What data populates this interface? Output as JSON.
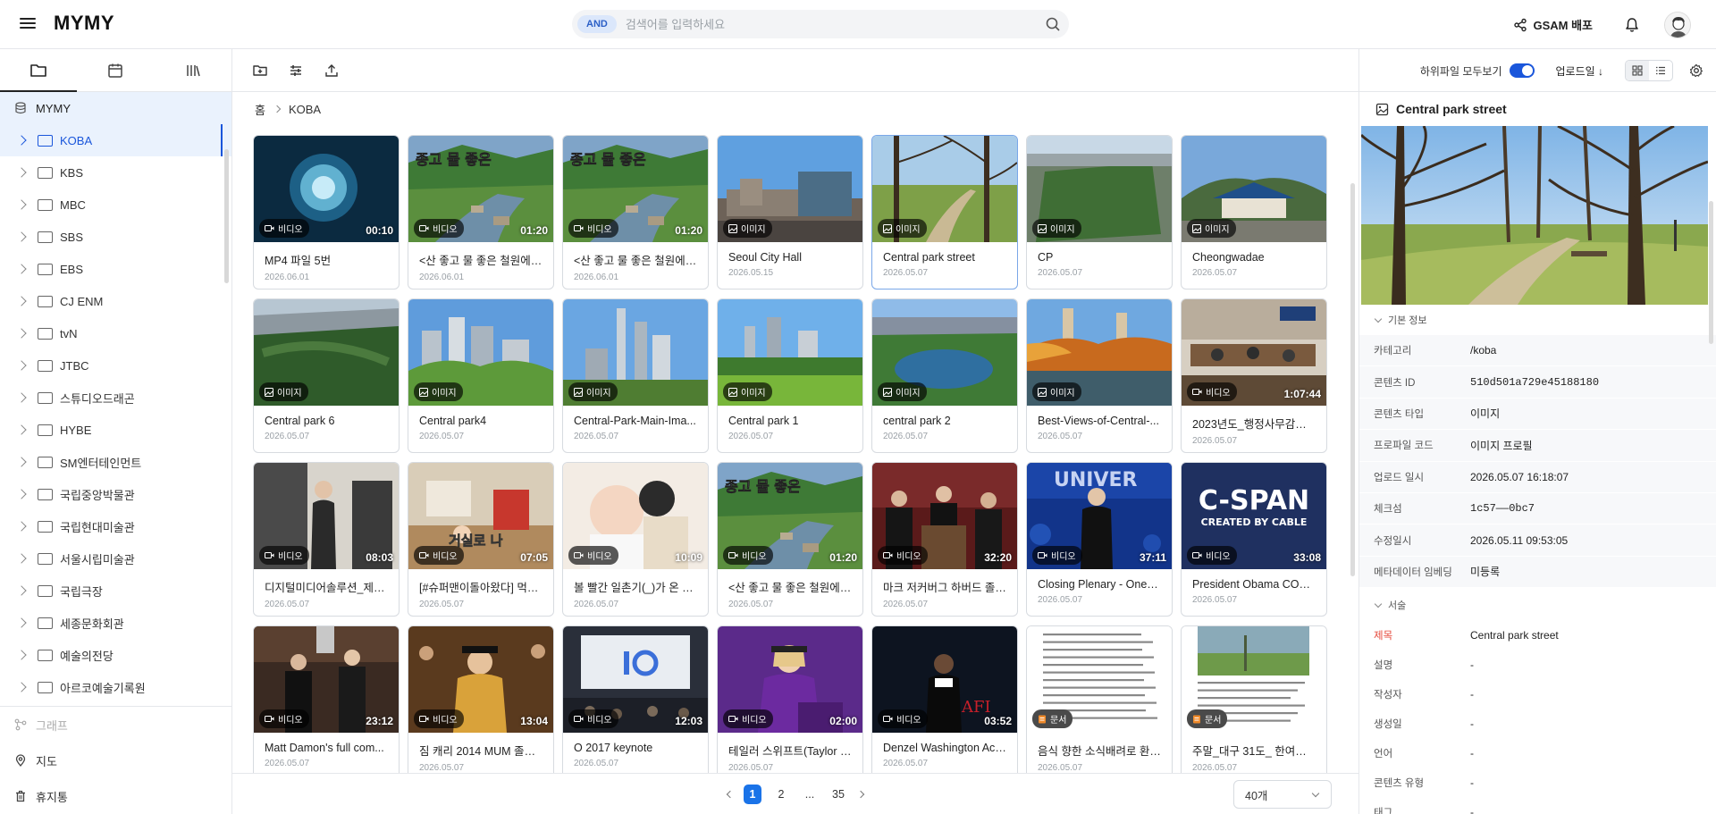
{
  "header": {
    "logo": "MYMY",
    "search_badge": "AND",
    "search_placeholder": "검색어를 입력하세요",
    "share_label": "GSAM 배포"
  },
  "sidebar": {
    "root": "MYMY",
    "items": [
      {
        "label": "KOBA",
        "active": true
      },
      {
        "label": "KBS"
      },
      {
        "label": "MBC"
      },
      {
        "label": "SBS"
      },
      {
        "label": "EBS"
      },
      {
        "label": "CJ ENM"
      },
      {
        "label": "tvN"
      },
      {
        "label": "JTBC"
      },
      {
        "label": "스튜디오드래곤"
      },
      {
        "label": "HYBE"
      },
      {
        "label": "SM엔터테인먼트"
      },
      {
        "label": "국립중앙박물관"
      },
      {
        "label": "국립현대미술관"
      },
      {
        "label": "서울시립미술관"
      },
      {
        "label": "국립극장"
      },
      {
        "label": "세종문화회관"
      },
      {
        "label": "예술의전당"
      },
      {
        "label": "아르코예술기록원"
      }
    ],
    "bottom": {
      "graph": "그래프",
      "map": "지도",
      "trash": "휴지통"
    }
  },
  "toolbar": {
    "subfolder_label": "하위파일 모두보기",
    "sort_label": "업로드일 ↓"
  },
  "breadcrumb": {
    "home": "홈",
    "current": "KOBA"
  },
  "cards": [
    {
      "title": "MP4 파일 5번",
      "date": "2026.06.01",
      "type": "비디오",
      "dur": "00:10",
      "art": "cell"
    },
    {
      "title": "<산 좋고 물 좋은 철원에 ...",
      "date": "2026.06.01",
      "type": "비디오",
      "dur": "01:20",
      "art": "river",
      "overlay": "종고 물 좋은"
    },
    {
      "title": "<산 좋고 물 좋은 철원에 ...",
      "date": "2026.06.01",
      "type": "비디오",
      "dur": "01:20",
      "art": "river",
      "overlay": "종고 물 좋은"
    },
    {
      "title": "Seoul City Hall",
      "date": "2026.05.15",
      "type": "이미지",
      "art": "cityhall"
    },
    {
      "title": "Central park street",
      "date": "2026.05.07",
      "type": "이미지",
      "art": "park",
      "selected": true
    },
    {
      "title": "CP",
      "date": "2026.05.07",
      "type": "이미지",
      "art": "aerial"
    },
    {
      "title": "Cheongwadae",
      "date": "2026.05.07",
      "type": "이미지",
      "art": "blue"
    },
    {
      "title": "Central park 6",
      "date": "2026.05.07",
      "type": "이미지",
      "art": "aerial2"
    },
    {
      "title": "Central park4",
      "date": "2026.05.07",
      "type": "이미지",
      "art": "city"
    },
    {
      "title": "Central-Park-Main-Ima...",
      "date": "2026.05.07",
      "type": "이미지",
      "art": "towers"
    },
    {
      "title": "Central park 1",
      "date": "2026.05.07",
      "type": "이미지",
      "art": "lawn"
    },
    {
      "title": "central park 2",
      "date": "2026.05.07",
      "type": "이미지",
      "art": "lake"
    },
    {
      "title": "Best-Views-of-Central-...",
      "date": "2026.05.07",
      "type": "이미지",
      "art": "autumn"
    },
    {
      "title": "2023년도_행정사무감사_...",
      "date": "2026.05.07",
      "type": "비디오",
      "dur": "1:07:44",
      "art": "meeting"
    },
    {
      "title": "디지털미디어솔루션_제머...",
      "date": "2026.05.07",
      "type": "비디오",
      "dur": "08:03",
      "art": "presenter"
    },
    {
      "title": "[#슈퍼맨이돌아왔다] 먹짱 ...",
      "date": "2026.05.07",
      "type": "비디오",
      "dur": "07:05",
      "art": "room",
      "overlay": "거실로 나"
    },
    {
      "title": "볼 빨간 일촌기(_)가 온 똥별...",
      "date": "2026.05.07",
      "type": "비디오",
      "dur": "10:09",
      "art": "baby"
    },
    {
      "title": "<산 좋고 물 좋은 철원에 ...",
      "date": "2026.05.07",
      "type": "비디오",
      "dur": "01:20",
      "art": "river",
      "overlay": "종고 물 좋은"
    },
    {
      "title": "마크 저커버그 하버드 졸업 ...",
      "date": "2026.05.07",
      "type": "비디오",
      "dur": "32:20",
      "art": "podium"
    },
    {
      "title": "Closing Plenary - One o...",
      "date": "2026.05.07",
      "type": "비디오",
      "dur": "37:11",
      "art": "clinton",
      "overlay": "UNIVER"
    },
    {
      "title": "President Obama COM...",
      "date": "2026.05.07",
      "type": "비디오",
      "dur": "33:08",
      "art": "cspan",
      "overlay": "C-SPAN",
      "overlay2": "CREATED BY CABLE"
    },
    {
      "title": "Matt Damon's full com...",
      "date": "2026.05.07",
      "type": "비디오",
      "dur": "23:12",
      "art": "grad"
    },
    {
      "title": "짐 캐리 2014 MUM 졸업...",
      "date": "2026.05.07",
      "type": "비디오",
      "dur": "13:04",
      "art": "gown"
    },
    {
      "title": "O 2017 keynote",
      "date": "2026.05.07",
      "type": "비디오",
      "dur": "12:03",
      "art": "io"
    },
    {
      "title": "테일러 스위프트(Taylor S...",
      "date": "2026.05.07",
      "type": "비디오",
      "dur": "02:00",
      "art": "taylor"
    },
    {
      "title": "Denzel Washington Acc...",
      "date": "2026.05.07",
      "type": "비디오",
      "dur": "03:52",
      "art": "afi",
      "overlay": "AFI"
    },
    {
      "title": "음식 향한 소식배려로 환길...",
      "date": "2026.05.07",
      "type": "문서",
      "art": "doc"
    },
    {
      "title": "주말_대구 31도_ 한여름 더...",
      "date": "2026.05.07",
      "type": "문서",
      "art": "doc2"
    }
  ],
  "pager": {
    "p1": "1",
    "p2": "2",
    "dots": "...",
    "last": "35",
    "per_page": "40개"
  },
  "detail": {
    "title": "Central park street",
    "basic_section": "기본 정보",
    "basic": [
      {
        "k": "카테고리",
        "v": "/koba"
      },
      {
        "k": "콘텐츠 ID",
        "v": "510d501a729e45188180",
        "mono": true
      },
      {
        "k": "콘텐츠 타입",
        "v": "이미지"
      },
      {
        "k": "프로파일 코드",
        "v": "이미지 프로필"
      },
      {
        "k": "업로드 일시",
        "v": "2026.05.07 16:18:07"
      },
      {
        "k": "체크섬",
        "v": "1c57——0bc7",
        "mono": true
      },
      {
        "k": "수정일시",
        "v": "2026.05.11 09:53:05"
      },
      {
        "k": "메타데이터 임베딩",
        "v": "미등록"
      }
    ],
    "desc_section": "서술",
    "desc": [
      {
        "k": "제목",
        "v": "Central park street",
        "red": true
      },
      {
        "k": "설명",
        "v": "-"
      },
      {
        "k": "작성자",
        "v": "-"
      },
      {
        "k": "생성일",
        "v": "-"
      },
      {
        "k": "언어",
        "v": "-"
      },
      {
        "k": "콘텐츠 유형",
        "v": "-"
      },
      {
        "k": "태그",
        "v": "-"
      }
    ]
  }
}
